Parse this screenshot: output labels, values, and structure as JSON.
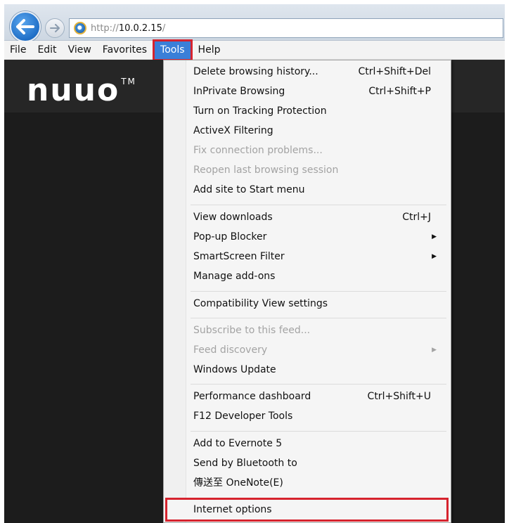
{
  "address_bar": {
    "url_scheme": "http://",
    "url_host": "10.0.2.15",
    "url_rest": "/"
  },
  "menubar": {
    "items": [
      "File",
      "Edit",
      "View",
      "Favorites",
      "Tools",
      "Help"
    ],
    "active": "Tools"
  },
  "page": {
    "logo_text": "nuuo",
    "logo_tm": "TM"
  },
  "tools_menu": {
    "items": [
      {
        "label": "Delete browsing history...",
        "shortcut": "Ctrl+Shift+Del"
      },
      {
        "label": "InPrivate Browsing",
        "shortcut": "Ctrl+Shift+P"
      },
      {
        "label": "Turn on Tracking Protection",
        "shortcut": ""
      },
      {
        "label": "ActiveX Filtering",
        "shortcut": ""
      },
      {
        "label": "Fix connection problems...",
        "shortcut": ""
      },
      {
        "label": "Reopen last browsing session",
        "shortcut": ""
      },
      {
        "label": "Add site to Start menu",
        "shortcut": ""
      },
      {
        "label": "View downloads",
        "shortcut": "Ctrl+J"
      },
      {
        "label": "Pop-up Blocker",
        "shortcut": ""
      },
      {
        "label": "SmartScreen Filter",
        "shortcut": ""
      },
      {
        "label": "Manage add-ons",
        "shortcut": ""
      },
      {
        "label": "Compatibility View settings",
        "shortcut": ""
      },
      {
        "label": "Subscribe to this feed...",
        "shortcut": ""
      },
      {
        "label": "Feed discovery",
        "shortcut": ""
      },
      {
        "label": "Windows Update",
        "shortcut": ""
      },
      {
        "label": "Performance dashboard",
        "shortcut": "Ctrl+Shift+U"
      },
      {
        "label": "F12 Developer Tools",
        "shortcut": ""
      },
      {
        "label": "Add to Evernote 5",
        "shortcut": ""
      },
      {
        "label": "Send by Bluetooth to",
        "shortcut": ""
      },
      {
        "label": "傳送至 OneNote(E)",
        "shortcut": ""
      },
      {
        "label": "Internet options",
        "shortcut": ""
      }
    ]
  },
  "colors": {
    "highlight_outline": "#d6232e",
    "menu_active_bg": "#3a7fd8",
    "disabled_text": "#a3a3a3"
  },
  "icons": [
    "back-arrow-icon",
    "forward-arrow-icon",
    "ie-page-icon",
    "submenu-arrow-icon"
  ]
}
